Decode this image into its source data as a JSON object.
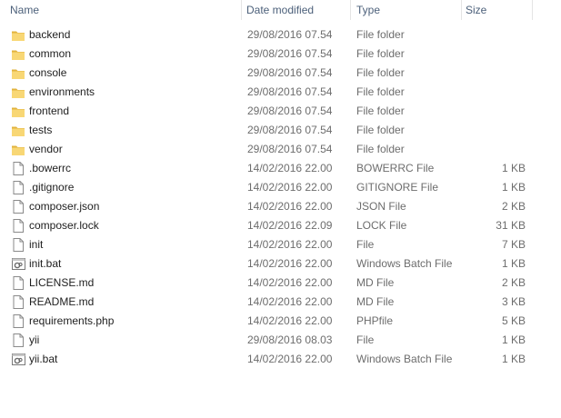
{
  "columns": {
    "name": "Name",
    "date": "Date modified",
    "type": "Type",
    "size": "Size"
  },
  "colors": {
    "folder": "#f8d775",
    "folder_dark": "#e2b33e",
    "header_text": "#4c607a",
    "meta_text": "#6d6d6d"
  },
  "files": [
    {
      "name": "backend",
      "date": "29/08/2016 07.54",
      "type": "File folder",
      "size": "",
      "icon": "folder-icon"
    },
    {
      "name": "common",
      "date": "29/08/2016 07.54",
      "type": "File folder",
      "size": "",
      "icon": "folder-icon"
    },
    {
      "name": "console",
      "date": "29/08/2016 07.54",
      "type": "File folder",
      "size": "",
      "icon": "folder-icon"
    },
    {
      "name": "environments",
      "date": "29/08/2016 07.54",
      "type": "File folder",
      "size": "",
      "icon": "folder-icon"
    },
    {
      "name": "frontend",
      "date": "29/08/2016 07.54",
      "type": "File folder",
      "size": "",
      "icon": "folder-icon"
    },
    {
      "name": "tests",
      "date": "29/08/2016 07.54",
      "type": "File folder",
      "size": "",
      "icon": "folder-icon"
    },
    {
      "name": "vendor",
      "date": "29/08/2016 07.54",
      "type": "File folder",
      "size": "",
      "icon": "folder-icon"
    },
    {
      "name": ".bowerrc",
      "date": "14/02/2016 22.00",
      "type": "BOWERRC File",
      "size": "1 KB",
      "icon": "file-icon"
    },
    {
      "name": ".gitignore",
      "date": "14/02/2016 22.00",
      "type": "GITIGNORE File",
      "size": "1 KB",
      "icon": "file-icon"
    },
    {
      "name": "composer.json",
      "date": "14/02/2016 22.00",
      "type": "JSON File",
      "size": "2 KB",
      "icon": "file-icon"
    },
    {
      "name": "composer.lock",
      "date": "14/02/2016 22.09",
      "type": "LOCK File",
      "size": "31 KB",
      "icon": "file-icon"
    },
    {
      "name": "init",
      "date": "14/02/2016 22.00",
      "type": "File",
      "size": "7 KB",
      "icon": "file-icon"
    },
    {
      "name": "init.bat",
      "date": "14/02/2016 22.00",
      "type": "Windows Batch File",
      "size": "1 KB",
      "icon": "batch-file-icon"
    },
    {
      "name": "LICENSE.md",
      "date": "14/02/2016 22.00",
      "type": "MD File",
      "size": "2 KB",
      "icon": "file-icon"
    },
    {
      "name": "README.md",
      "date": "14/02/2016 22.00",
      "type": "MD File",
      "size": "3 KB",
      "icon": "file-icon"
    },
    {
      "name": "requirements.php",
      "date": "14/02/2016 22.00",
      "type": "PHPfile",
      "size": "5 KB",
      "icon": "file-icon"
    },
    {
      "name": "yii",
      "date": "29/08/2016 08.03",
      "type": "File",
      "size": "1 KB",
      "icon": "file-icon"
    },
    {
      "name": "yii.bat",
      "date": "14/02/2016 22.00",
      "type": "Windows Batch File",
      "size": "1 KB",
      "icon": "batch-file-icon"
    }
  ]
}
